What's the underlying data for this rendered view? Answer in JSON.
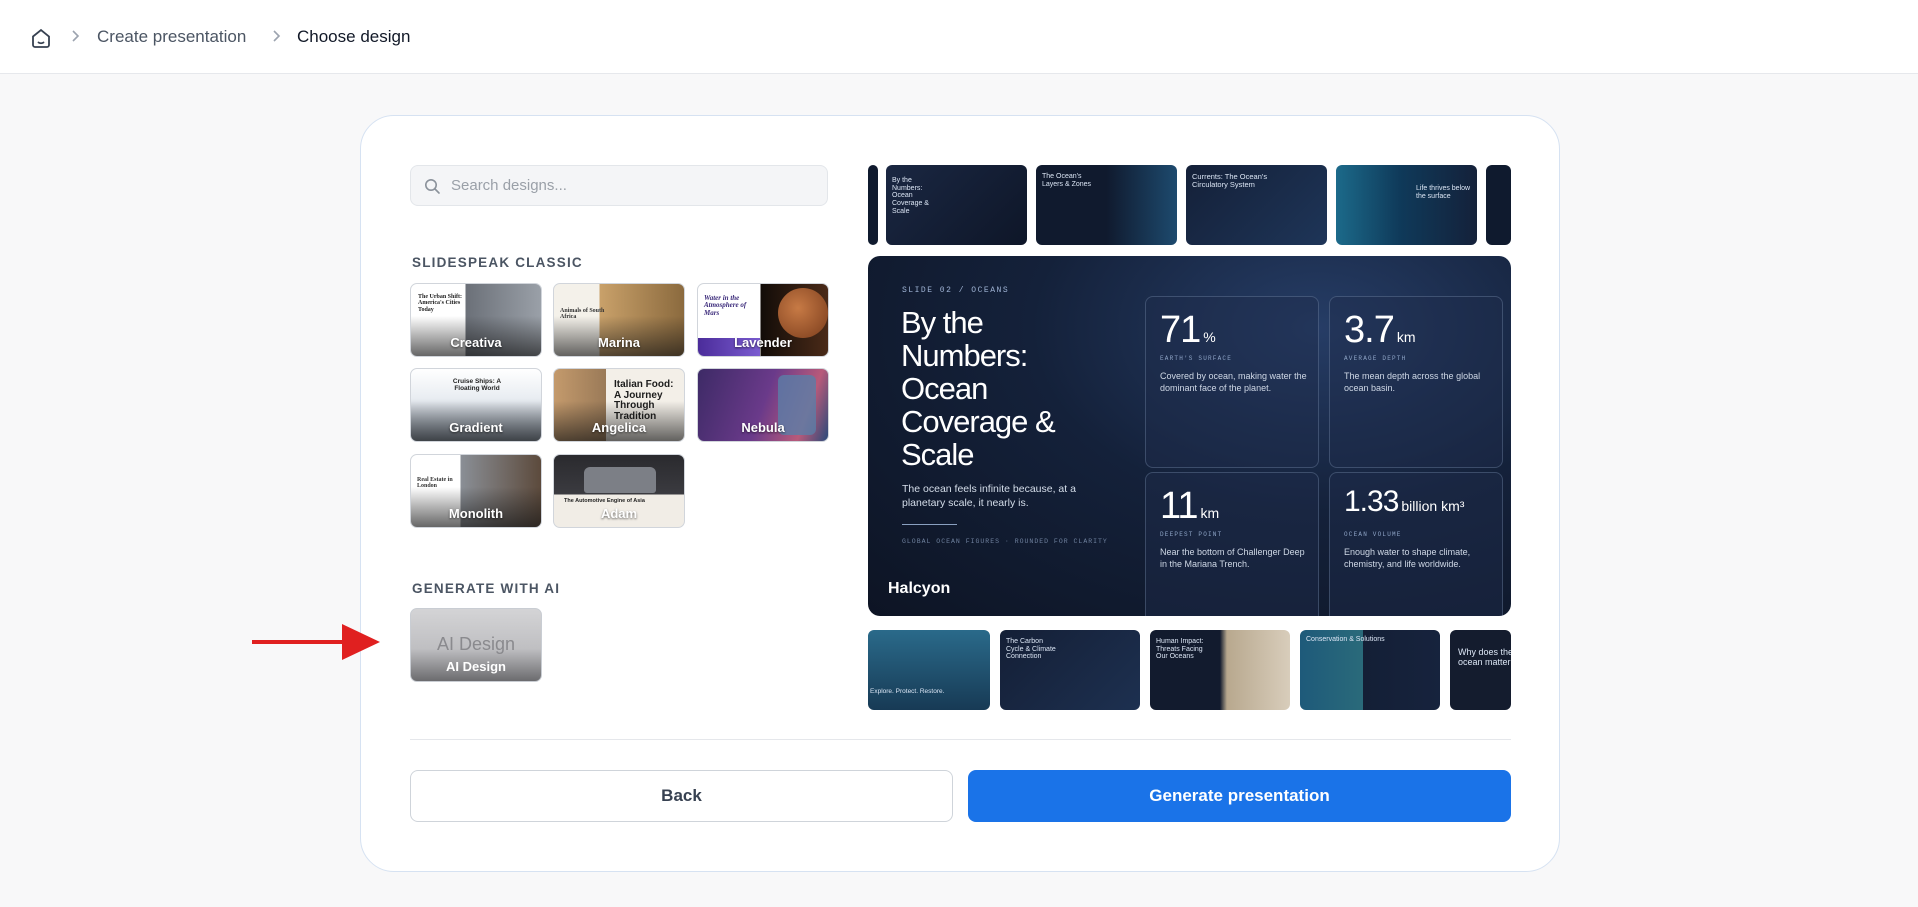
{
  "breadcrumb": {
    "home_icon": "home-icon",
    "items": [
      "Create presentation",
      "Choose design"
    ]
  },
  "search": {
    "placeholder": "Search designs..."
  },
  "sections": {
    "classic": "SLIDESPEAK CLASSIC",
    "ai": "GENERATE WITH AI"
  },
  "designs": [
    {
      "name": "Creativa",
      "title": "The Urban Shift: America's Cities Today"
    },
    {
      "name": "Marina",
      "title": "Animals of South Africa"
    },
    {
      "name": "Lavender",
      "title": "Water in the Atmosphere of Mars"
    },
    {
      "name": "Gradient",
      "title": "Cruise Ships: A Floating World"
    },
    {
      "name": "Angelica",
      "title": "Italian Food: A Journey Through Tradition"
    },
    {
      "name": "Nebula",
      "title": ""
    },
    {
      "name": "Monolith",
      "title": "Real Estate in London"
    },
    {
      "name": "Adam",
      "title": "The Automotive Engine of Asia"
    }
  ],
  "ai_design": {
    "big": "AI Design",
    "label": "AI Design"
  },
  "preview": {
    "kicker": "SLIDE 02 / OCEANS",
    "title": "By the Numbers: Ocean Coverage & Scale",
    "description": "The ocean feels infinite because, at a planetary scale, it nearly is.",
    "footer": "GLOBAL OCEAN FIGURES · ROUNDED FOR CLARITY",
    "design_name": "Halcyon",
    "stats": [
      {
        "value": "71",
        "unit": "%",
        "caption": "EARTH'S SURFACE",
        "text": "Covered by ocean, making water the dominant face of the planet."
      },
      {
        "value": "3.7",
        "unit": "km",
        "caption": "AVERAGE DEPTH",
        "text": "The mean depth across the global ocean basin."
      },
      {
        "value": "11",
        "unit": "km",
        "caption": "DEEPEST POINT",
        "text": "Near the bottom of Challenger Deep in the Mariana Trench."
      },
      {
        "value": "1.33",
        "unit": "billion km³",
        "caption": "OCEAN VOLUME",
        "text": "Enough water to shape climate, chemistry, and life worldwide."
      }
    ]
  },
  "top_strip": [
    {
      "title": "By the Numbers: Ocean Coverage & Scale"
    },
    {
      "title": "The Ocean's Layers & Zones"
    },
    {
      "title": "Currents: The Ocean's Circulatory System"
    },
    {
      "title": "Life thrives below the surface"
    }
  ],
  "bottom_strip": [
    {
      "title": "Explore. Protect. Restore."
    },
    {
      "title": "The Carbon Cycle & Climate Connection"
    },
    {
      "title": "Human Impact: Threats Facing Our Oceans"
    },
    {
      "title": "Conservation & Solutions"
    },
    {
      "title": "Why does the ocean matter"
    }
  ],
  "buttons": {
    "back": "Back",
    "generate": "Generate presentation"
  },
  "colors": {
    "accent": "#1a73e8",
    "arrow": "#e02020"
  }
}
